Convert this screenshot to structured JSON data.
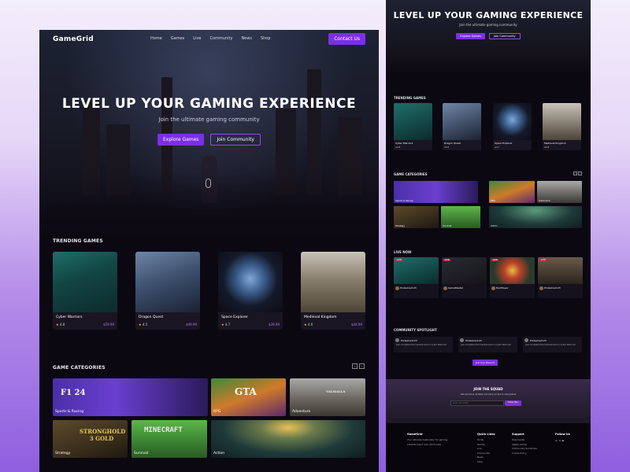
{
  "brand": "GameGrid",
  "nav": [
    "Home",
    "Games",
    "Live",
    "Community",
    "News",
    "Shop"
  ],
  "contact_label": "Contact Us",
  "hero": {
    "title": "LEVEL UP YOUR GAMING EXPERIENCE",
    "subtitle": "Join the ultimate gaming community",
    "primary_label": "Explore Games",
    "secondary_label": "Join Community"
  },
  "trending": {
    "title": "TRENDING GAMES",
    "cards": [
      {
        "title": "Cyber Warriors",
        "rating": "4.8",
        "price": "$59.99"
      },
      {
        "title": "Dragon Quest",
        "rating": "4.5",
        "price": "$49.99"
      },
      {
        "title": "Space Explorer",
        "rating": "4.7",
        "price": "$39.99"
      },
      {
        "title": "Medieval Kingdom",
        "rating": "4.6",
        "price": "$44.99"
      }
    ]
  },
  "categories": {
    "title": "GAME CATEGORIES",
    "items": [
      {
        "label": "Sports & Racing",
        "art": "F1 24"
      },
      {
        "label": "RPG",
        "art": "GTA"
      },
      {
        "label": "Adventure",
        "art": "VALHALLA"
      },
      {
        "label": "Strategy",
        "art": "STRONGHOLD 3 GOLD"
      },
      {
        "label": "Survival",
        "art": "MINECRAFT"
      },
      {
        "label": "Action",
        "art": ""
      }
    ]
  },
  "side": {
    "live": {
      "title": "LIVE NOW",
      "badge": "LIVE",
      "streamers": [
        "ProGamer123",
        "GameMaster",
        "EpicPlayer",
        "ProGamer123"
      ]
    },
    "spotlight": {
      "title": "COMMUNITY SPOTLIGHT",
      "posts": [
        {
          "user": "ProGamer123",
          "text": "Just completed the hardest level in Cyber Warriors!"
        },
        {
          "user": "ProGamer123",
          "text": "Just completed the hardest level in Cyber Warriors!"
        },
        {
          "user": "ProGamer123",
          "text": "Just completed the hardest level in Cyber Warriors!"
        }
      ],
      "join_label": "Join Our Discord"
    },
    "squad": {
      "title": "JOIN THE SQUAD",
      "text": "Get exclusive updates and early access to new games",
      "placeholder": "Enter your email",
      "subscribe_label": "Subscribe"
    },
    "footer": {
      "brand": "GameGrid",
      "tagline": "Your ultimate destination for gaming entertainment and community.",
      "quick_title": "Quick Links",
      "quick": [
        "Home",
        "Games",
        "Live",
        "Community",
        "News",
        "Shop"
      ],
      "support_title": "Support",
      "support": [
        "Help Center",
        "Safety Center",
        "Community Guidelines",
        "Cookie Policy"
      ],
      "follow_title": "Follow Us"
    }
  },
  "colors": {
    "accent": "#7b2fe6",
    "background": "#0b0812",
    "card": "#1a1522"
  }
}
